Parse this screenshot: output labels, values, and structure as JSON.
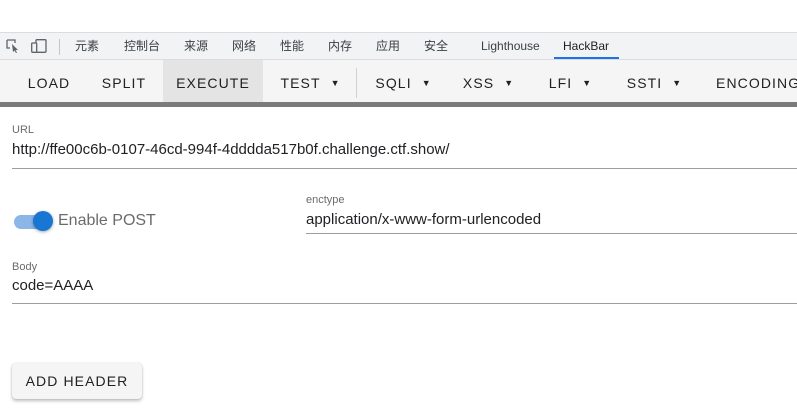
{
  "devtools_tabs": {
    "elements": "元素",
    "console": "控制台",
    "sources": "来源",
    "network": "网络",
    "performance": "性能",
    "memory": "内存",
    "application": "应用",
    "security": "安全",
    "lighthouse": "Lighthouse",
    "hackbar": "HackBar"
  },
  "toolbar": {
    "load": "LOAD",
    "split": "SPLIT",
    "execute": "EXECUTE",
    "test": "TEST",
    "sqli": "SQLI",
    "xss": "XSS",
    "lfi": "LFI",
    "ssti": "SSTI",
    "encoding": "ENCODING",
    "caret": "▼"
  },
  "url": {
    "label": "URL",
    "value": "http://ffe00c6b-0107-46cd-994f-4dddda517b0f.challenge.ctf.show/"
  },
  "enable_post": {
    "label": "Enable POST",
    "checked": true
  },
  "enctype": {
    "label": "enctype",
    "value": "application/x-www-form-urlencoded"
  },
  "body": {
    "label": "Body",
    "value": "code=AAAA"
  },
  "add_header": {
    "label": "ADD HEADER"
  },
  "colors": {
    "accent": "#1a73e8",
    "switch_on": "#1976d2",
    "toolbar_bg": "#f5f5f5"
  }
}
